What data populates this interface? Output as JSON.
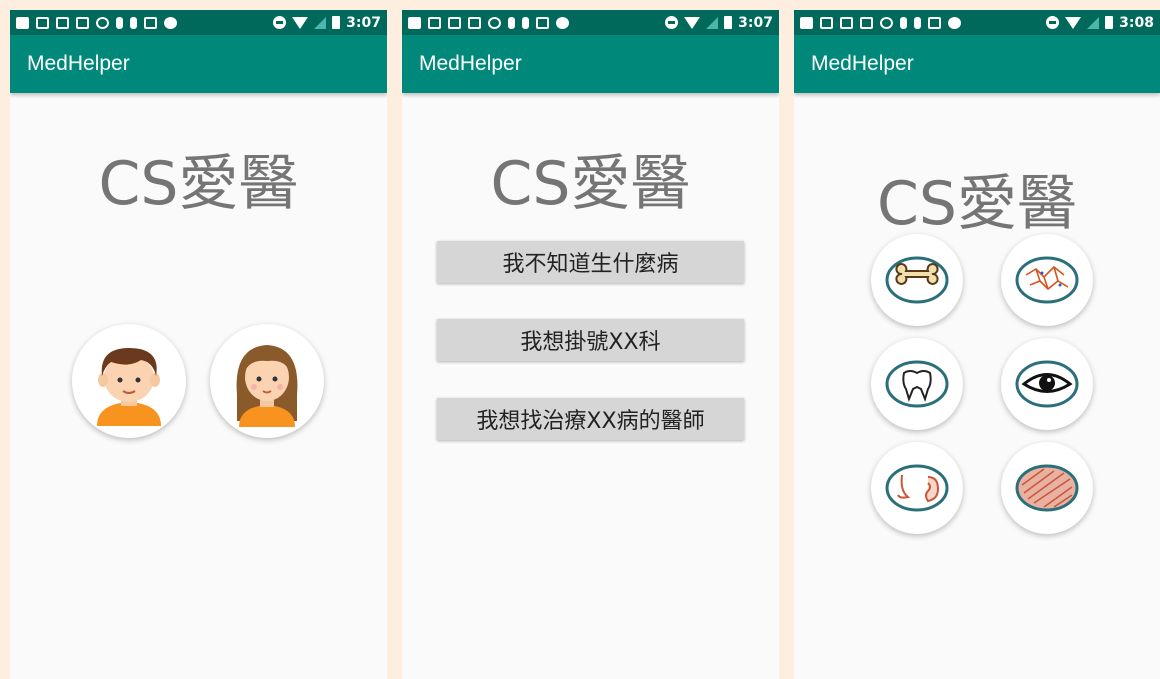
{
  "status_bar": {
    "time_1": "3:07",
    "time_2": "3:07",
    "time_3": "3:08"
  },
  "app_name": "MedHelper",
  "logo_text": "CS愛醫",
  "screen1": {
    "gender_options": [
      {
        "name": "male"
      },
      {
        "name": "female"
      }
    ]
  },
  "screen2": {
    "buttons": [
      {
        "label": "我不知道生什麼病"
      },
      {
        "label": "我想掛號XX科"
      },
      {
        "label": "我想找治療XX病的醫師"
      }
    ]
  },
  "screen3": {
    "body_parts": [
      "bone",
      "skin",
      "tooth",
      "eye",
      "ear-nose",
      "blood"
    ]
  },
  "colors": {
    "statusbar": "#00695c",
    "appbar": "#00897b",
    "background": "#fafafa",
    "outer_background": "#fdeee0",
    "title_gray": "#757575"
  }
}
